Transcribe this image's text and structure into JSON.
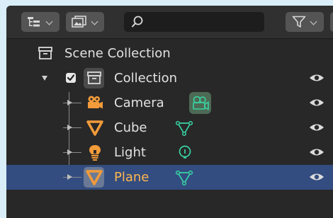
{
  "colors": {
    "background": "#d9eef9",
    "panel": "#282828",
    "header": "#303030",
    "selection": "#334d80",
    "selected_text": "#ffb54d",
    "object_orange": "#f29b3a",
    "data_green": "#38d3a3",
    "text": "#e2e2e2"
  },
  "header": {
    "display_mode_icon": "outliner-view-icon",
    "filter_icon": "filter-funnel-icon",
    "search_icon": "magnifier-icon",
    "search_value": ""
  },
  "tree": {
    "scene_collection": {
      "label": "Scene Collection",
      "icon": "collection-box-icon"
    },
    "collection": {
      "label": "Collection",
      "icon": "collection-box-icon",
      "checked": true,
      "expanded": true,
      "visible": true
    },
    "objects": [
      {
        "label": "Camera",
        "icon": "camera-icon",
        "data_icon": "camera-data-icon",
        "visible": true,
        "selected": false
      },
      {
        "label": "Cube",
        "icon": "mesh-cone-icon",
        "data_icon": "mesh-data-icon",
        "visible": true,
        "selected": false
      },
      {
        "label": "Light",
        "icon": "light-bulb-icon",
        "data_icon": "light-data-icon",
        "visible": true,
        "selected": false
      },
      {
        "label": "Plane",
        "icon": "mesh-cone-icon",
        "data_icon": "mesh-data-icon",
        "visible": true,
        "selected": true
      }
    ]
  }
}
